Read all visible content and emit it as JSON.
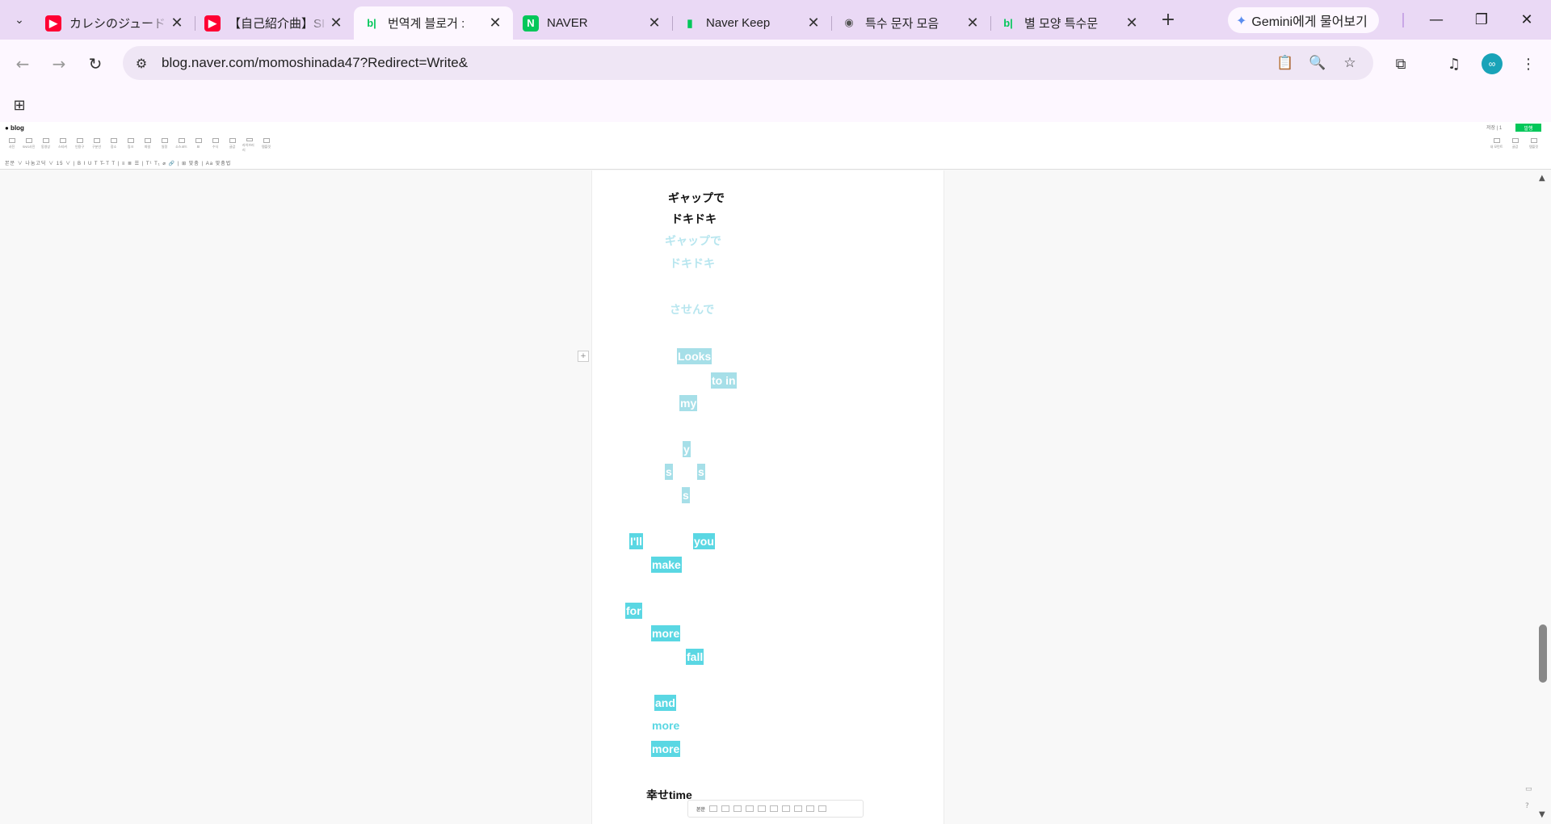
{
  "browser": {
    "tab_search_icon": "chevron-down-icon",
    "tabs": [
      {
        "title": "カレシのジュード",
        "favicon": "youtube",
        "active": false
      },
      {
        "title": "【自己紹介曲】SI",
        "favicon": "youtube",
        "active": false
      },
      {
        "title": "번역계 블로거 :",
        "favicon": "blog",
        "active": true
      },
      {
        "title": "NAVER",
        "favicon": "naver",
        "active": false
      },
      {
        "title": "Naver Keep",
        "favicon": "keep",
        "active": false
      },
      {
        "title": "특수 문자 모음",
        "favicon": "globe",
        "active": false
      },
      {
        "title": "별 모양 특수문",
        "favicon": "blog",
        "active": false
      }
    ],
    "favicon_text": {
      "youtube": "▶",
      "blog": "b|",
      "naver": "N",
      "keep": "▮",
      "globe": "◉"
    },
    "close_glyph": "✕",
    "new_tab_glyph": "+",
    "gemini_label": "Gemini에게 물어보기",
    "window_controls": {
      "minimize": "—",
      "restore": "❐",
      "close": "✕"
    },
    "nav": {
      "back": "←",
      "forward": "→",
      "reload": "↻"
    },
    "url": "blog.naver.com/momoshinada47?Redirect=Write&",
    "site_info_icon": "⚙",
    "omnibox_icons": {
      "clipboard": "📋",
      "zoom": "🔍",
      "bookmark": "☆"
    },
    "toolbar_icons": {
      "extensions": "⧉",
      "media": "♫",
      "menu": "⋮"
    },
    "avatar_text": "∞",
    "apps_icon": "⊞"
  },
  "editor": {
    "logo": "● blog",
    "top_right_text": "저장 | 1",
    "publish_label": "발행",
    "tools": [
      "사진",
      "SNS사진",
      "동영상",
      "스티커",
      "인용구",
      "구분선",
      "장소",
      "링크",
      "파일",
      "일정",
      "소스코드",
      "표",
      "수식",
      "글감",
      "라이브러리",
      "템플릿"
    ],
    "right_tools": [
      "내 모먼트",
      "글감",
      "템플릿"
    ],
    "format_bar": "본문 ∨  나눔고딕 ∨  15 ∨  | B  I  U  T  T̶  T  T | ≡  ≣  ☰ | T¹  T₁  ⌀  🔗 | ⊞ 맞춤 | Aa 맞춤법",
    "plus_marker": "+"
  },
  "content": {
    "lines": [
      {
        "text": "ギャップで",
        "style": "black"
      },
      {
        "text": "ドキドキ",
        "style": "black"
      },
      {
        "text": "ギャップで",
        "style": "pale"
      },
      {
        "text": "ドキドキ",
        "style": "pale"
      },
      {
        "text": "させんで",
        "style": "pale"
      },
      {
        "text": "Looks",
        "style": "hl-light"
      },
      {
        "text": "to in",
        "style": "hl-light"
      },
      {
        "text": "my",
        "style": "hl-light"
      },
      {
        "text": "y",
        "style": "hl-light"
      },
      {
        "text": "s",
        "style": "hl-light"
      },
      {
        "text": "s",
        "style": "hl-light"
      },
      {
        "text": "s",
        "style": "hl-light"
      },
      {
        "text": "I'll",
        "style": "hl-cyan"
      },
      {
        "text": "you",
        "style": "hl-cyan"
      },
      {
        "text": "make",
        "style": "hl-cyan"
      },
      {
        "text": "for",
        "style": "hl-cyan"
      },
      {
        "text": "more",
        "style": "hl-cyan"
      },
      {
        "text": "fall",
        "style": "hl-cyan"
      },
      {
        "text": "and",
        "style": "hl-cyan"
      },
      {
        "text": "more",
        "style": "hl-cyan"
      },
      {
        "text": "more",
        "style": "hl-cyan"
      },
      {
        "text": "幸せtime",
        "style": "black"
      }
    ]
  },
  "bottom_bar": {
    "label": "본문"
  },
  "scroll": {
    "up": "▲",
    "down": "▼",
    "position": 0.73
  }
}
